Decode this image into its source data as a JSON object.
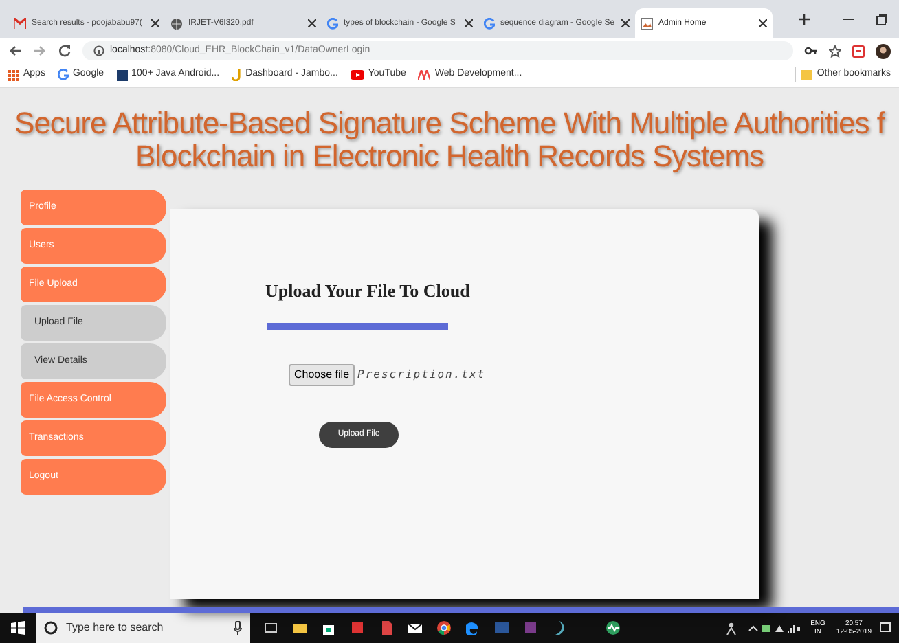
{
  "tabs": [
    {
      "label": "Search results - poojababu97(",
      "selected": false,
      "kind": "mail"
    },
    {
      "label": "IRJET-V6I320.pdf",
      "selected": false,
      "kind": "globe"
    },
    {
      "label": "types of blockchain - Google S",
      "selected": false,
      "kind": "google"
    },
    {
      "label": "sequence diagram - Google Se",
      "selected": false,
      "kind": "google"
    },
    {
      "label": "Admin Home",
      "selected": true,
      "kind": "page"
    }
  ],
  "address": {
    "host": "localhost",
    "path": ":8080/Cloud_EHR_BlockChain_v1/DataOwnerLogin"
  },
  "bookmarks": [
    {
      "label": "Apps",
      "kind": "apps"
    },
    {
      "label": "Google",
      "kind": "google"
    },
    {
      "label": "100+ Java Android...",
      "kind": "square"
    },
    {
      "label": "Dashboard - Jambo...",
      "kind": "j"
    },
    {
      "label": "YouTube",
      "kind": "youtube"
    },
    {
      "label": "Web Development...",
      "kind": "web"
    }
  ],
  "other_bookmarks": "Other bookmarks",
  "title_lines": [
    "Secure Attribute-Based Signature Scheme With Multiple Authorities f",
    "Blockchain in Electronic Health Records Systems"
  ],
  "sidebar": {
    "items": [
      {
        "label": "Profile",
        "kind": "main"
      },
      {
        "label": "Users",
        "kind": "main"
      },
      {
        "label": "File Upload",
        "kind": "main"
      },
      {
        "label": "Upload File",
        "kind": "sub"
      },
      {
        "label": "View Details",
        "kind": "sub"
      },
      {
        "label": "File Access Control",
        "kind": "main"
      },
      {
        "label": "Transactions",
        "kind": "main"
      },
      {
        "label": "Logout",
        "kind": "main"
      }
    ]
  },
  "card": {
    "heading": "Upload Your File To Cloud",
    "choose_button": "Choose file",
    "file_name": "Prescription.txt",
    "upload_button": "Upload File"
  },
  "taskbar": {
    "search_placeholder": "Type here to search",
    "language": "ENG",
    "region": "IN",
    "time": "20:57",
    "date": "12-05-2019"
  }
}
